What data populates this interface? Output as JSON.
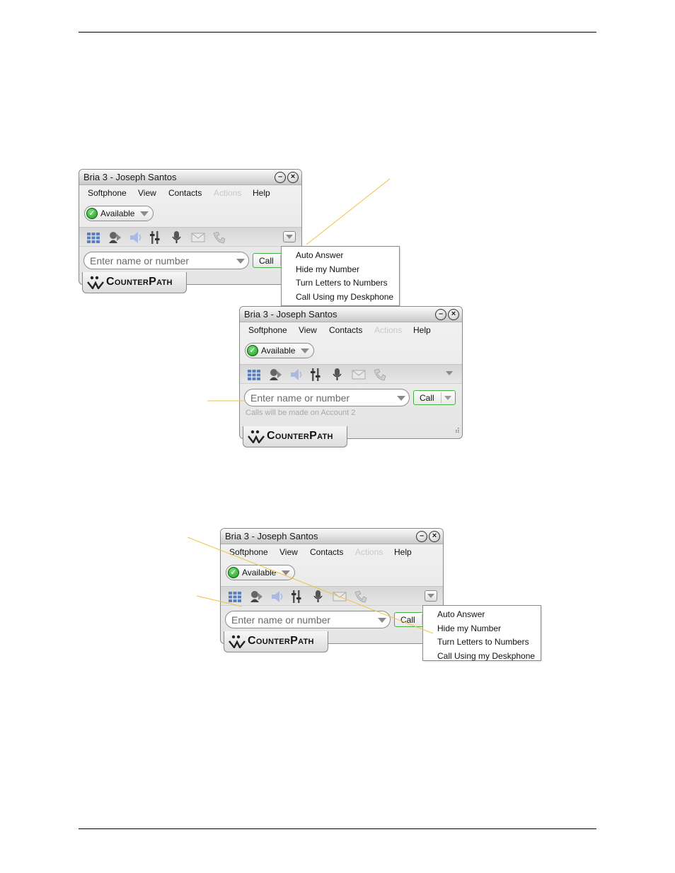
{
  "window": {
    "title": "Bria 3 - Joseph Santos",
    "menu": [
      "Softphone",
      "View",
      "Contacts",
      "Actions",
      "Help"
    ],
    "presence": "Available",
    "dial_placeholder": "Enter name or number",
    "call_label": "Call",
    "brand": "CounterPath",
    "icons": [
      "dialpad-icon",
      "contacts-icon",
      "speaker-icon",
      "audio-tuning-icon",
      "microphone-icon",
      "mail-icon",
      "history-icon"
    ]
  },
  "screenshot2": {
    "account_note": "Calls will be made on Account 2"
  },
  "dropdown": {
    "items": [
      "Auto Answer",
      "Hide my Number",
      "Turn Letters to Numbers",
      "Call Using my Deskphone"
    ]
  },
  "colors": {
    "callout_line": "#f0c040",
    "call_border": "#46b046",
    "presence_green": "#1b9a1b"
  }
}
